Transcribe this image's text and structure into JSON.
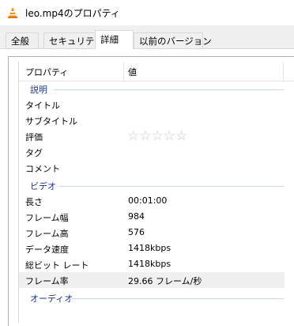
{
  "window": {
    "title": "leo.mp4のプロパティ",
    "icon": "vlc-cone-icon"
  },
  "tabs": [
    {
      "label": "全般"
    },
    {
      "label": "セキュリティ"
    },
    {
      "label": "詳細",
      "active": true
    },
    {
      "label": "以前のバージョン"
    }
  ],
  "columns": {
    "property": "プロパティ",
    "value": "値"
  },
  "groups": {
    "description": "説明",
    "video": "ビデオ",
    "audio": "オーディオ"
  },
  "description_rows": [
    {
      "label": "タイトル",
      "value": ""
    },
    {
      "label": "サブタイトル",
      "value": ""
    },
    {
      "label": "評価",
      "stars": "☆☆☆☆☆",
      "rating": 0
    },
    {
      "label": "タグ",
      "value": ""
    },
    {
      "label": "コメント",
      "value": ""
    }
  ],
  "video_rows": [
    {
      "label": "長さ",
      "value": "00:01:00"
    },
    {
      "label": "フレーム幅",
      "value": "984"
    },
    {
      "label": "フレーム高",
      "value": "576"
    },
    {
      "label": "データ速度",
      "value": "1418kbps"
    },
    {
      "label": "総ビット レート",
      "value": "1418kbps"
    },
    {
      "label": "フレーム率",
      "value": "29.66 フレーム/秒"
    }
  ]
}
